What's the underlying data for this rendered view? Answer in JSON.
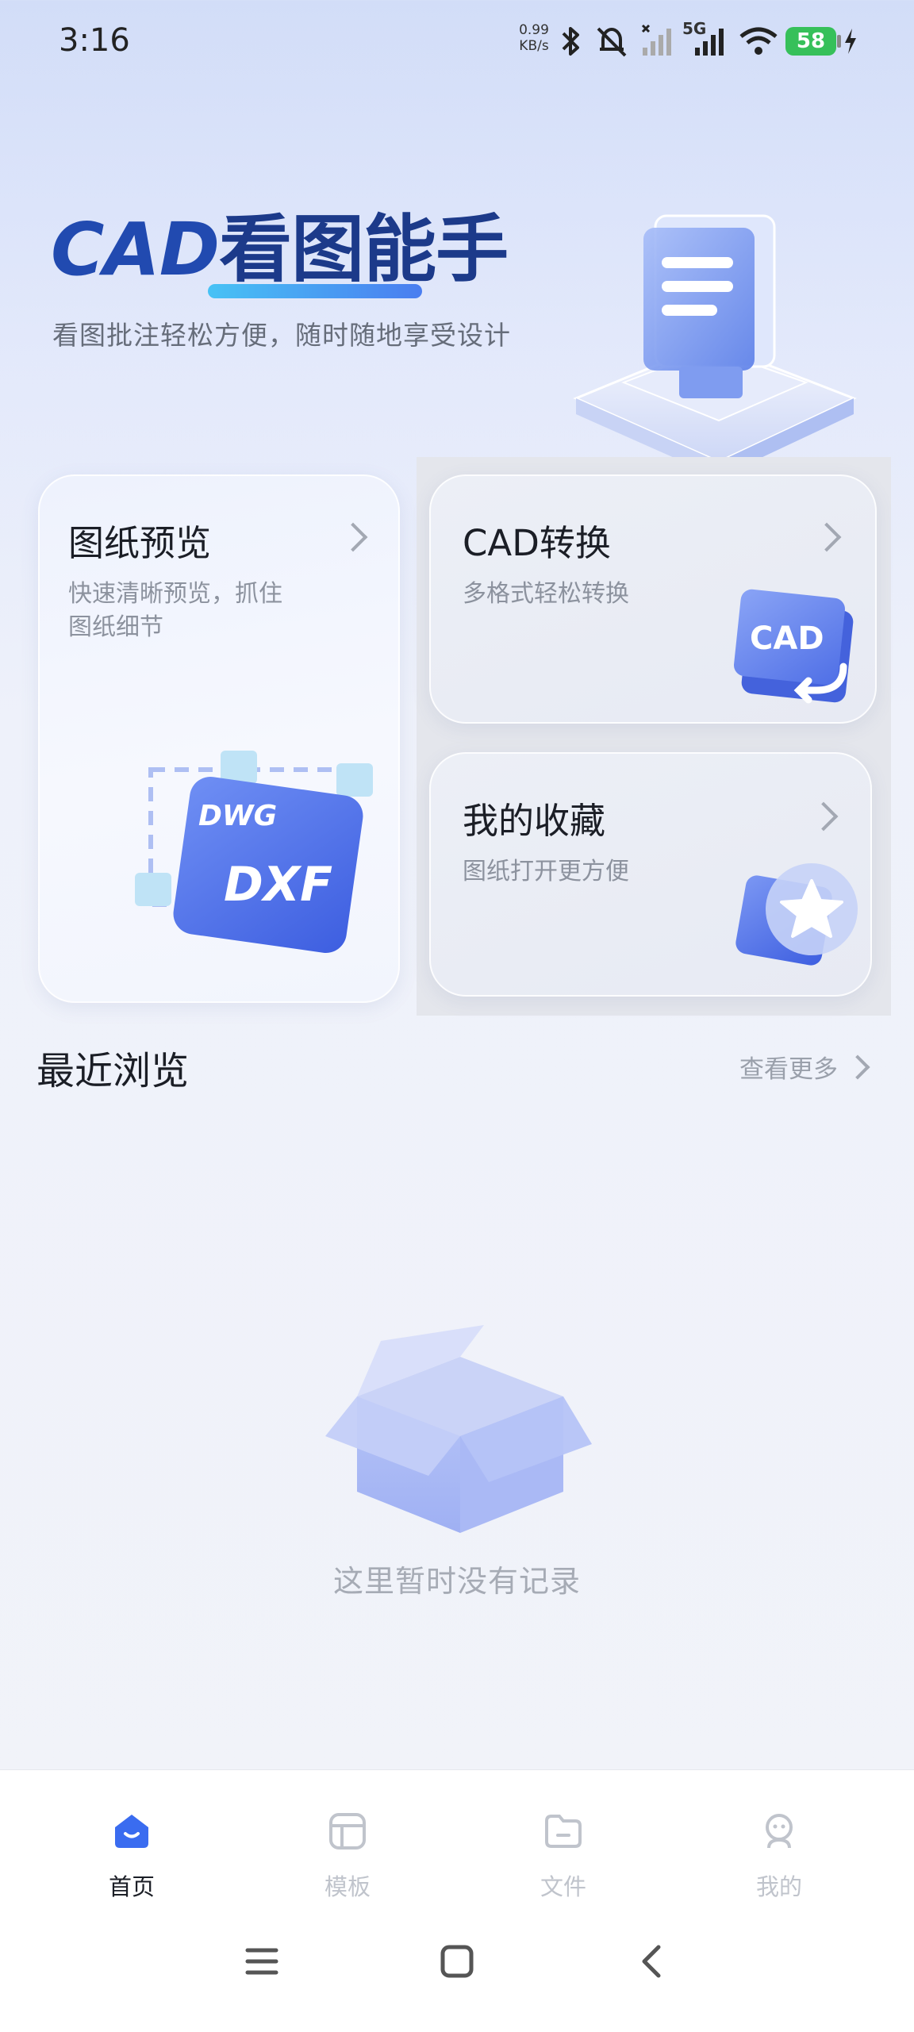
{
  "status_bar": {
    "time": "3:16",
    "net_speed_value": "0.99",
    "net_speed_unit": "KB/s",
    "network_type": "5G",
    "battery": "58",
    "icons": [
      "bluetooth-icon",
      "mute-icon",
      "signal-icon",
      "signal-5g-icon",
      "wifi-icon",
      "battery-icon",
      "charging-icon"
    ]
  },
  "hero": {
    "title_prefix": "CAD",
    "title_suffix": "看图能手",
    "subtitle": "看图批注轻松方便，随时随地享受设计"
  },
  "cards": {
    "preview": {
      "title": "图纸预览",
      "desc_line1": "快速清晰预览，抓住",
      "desc_line2": "图纸细节",
      "badge1": "DWG",
      "badge2": "DXF"
    },
    "convert": {
      "title": "CAD转换",
      "desc": "多格式轻松转换",
      "badge": "CAD"
    },
    "favorites": {
      "title": "我的收藏",
      "desc": "图纸打开更方便"
    }
  },
  "recent": {
    "title": "最近浏览",
    "more": "查看更多",
    "empty_text": "这里暂时没有记录"
  },
  "tab_bar": {
    "active_color": "#3a6cf0",
    "inactive_color": "#c0c4cc",
    "tabs": [
      {
        "label": "首页",
        "icon": "home-icon",
        "active": true
      },
      {
        "label": "模板",
        "icon": "template-icon",
        "active": false
      },
      {
        "label": "文件",
        "icon": "folder-icon",
        "active": false
      },
      {
        "label": "我的",
        "icon": "profile-icon",
        "active": false
      }
    ]
  },
  "system_nav": [
    "menu-icon",
    "home-square-icon",
    "back-icon"
  ]
}
